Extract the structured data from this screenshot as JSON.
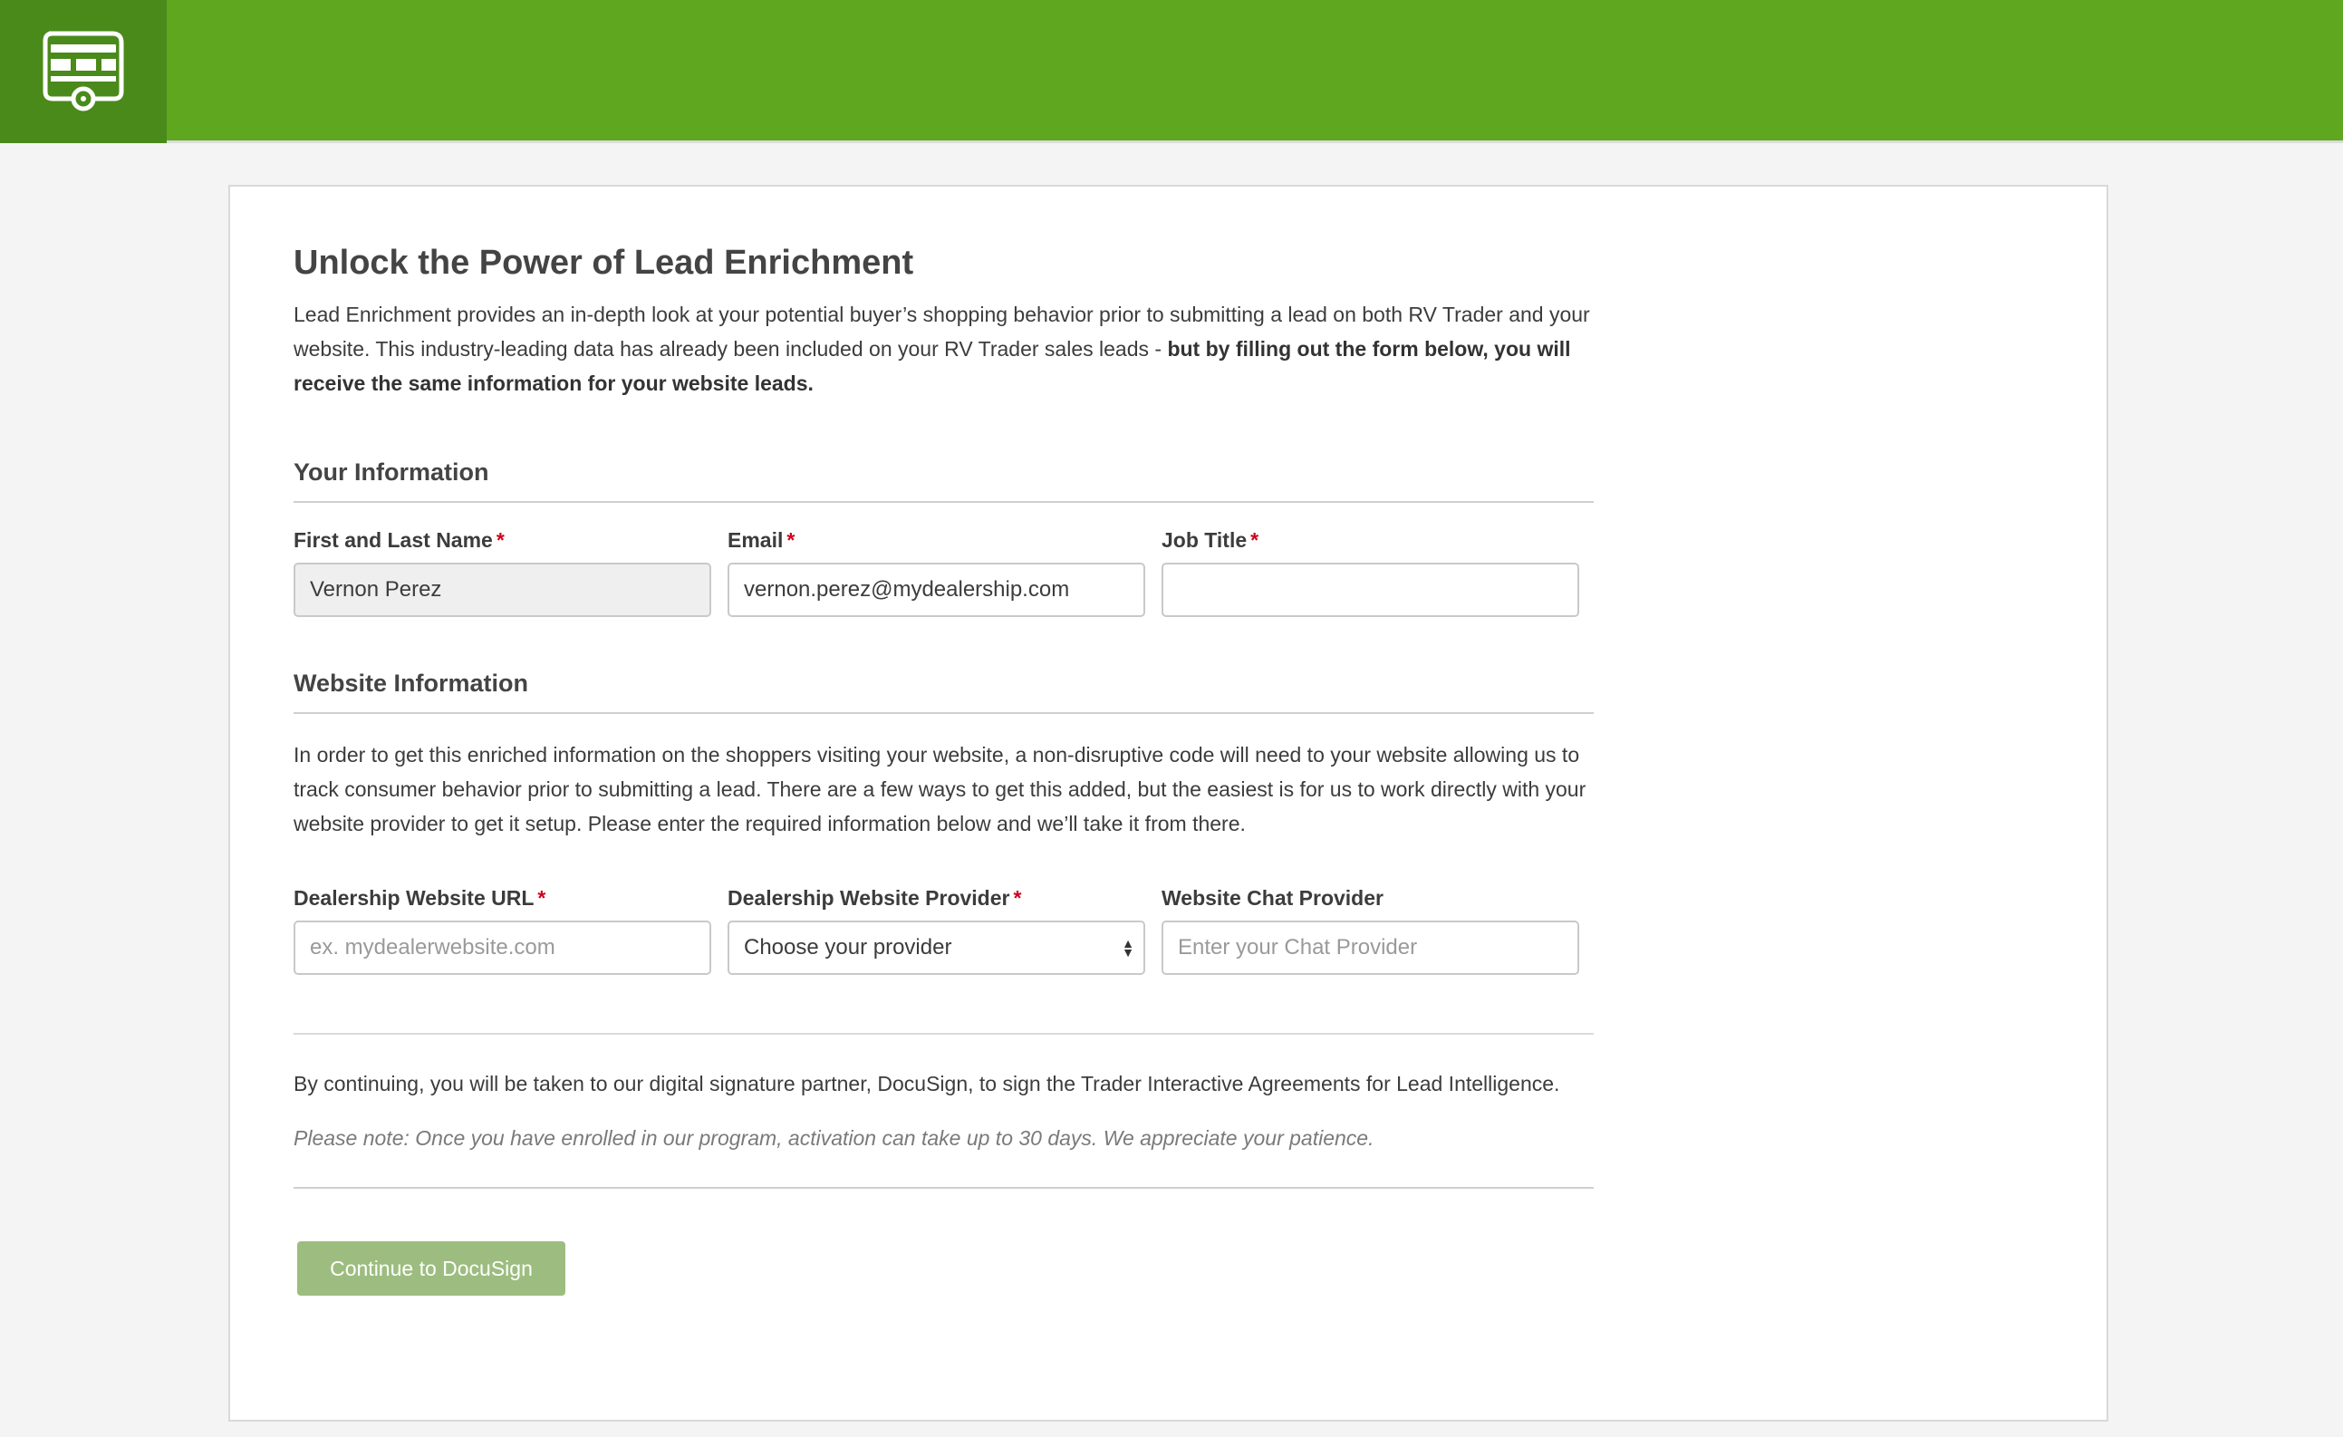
{
  "colors": {
    "header_bg": "#5ea71f",
    "logo_bg": "#4a8a1a",
    "required_star": "#d0021b",
    "button_bg": "#9cbd7f"
  },
  "header": {
    "logo_icon": "rv-camper-icon"
  },
  "page": {
    "title": "Unlock the Power of Lead Enrichment",
    "intro_regular": "Lead Enrichment provides an in-depth look at your potential buyer’s shopping behavior prior to submitting a lead on both RV Trader and your website. This industry-leading data has already been included on your RV Trader sales leads - ",
    "intro_bold": "but by filling out the form below, you will receive the same information for your website leads."
  },
  "your_information": {
    "heading": "Your Information",
    "name": {
      "label": "First and Last Name",
      "required": "*",
      "value": "Vernon Perez"
    },
    "email": {
      "label": "Email",
      "required": "*",
      "value": "vernon.perez@mydealership.com"
    },
    "job_title": {
      "label": "Job Title",
      "required": "*",
      "value": ""
    }
  },
  "website_information": {
    "heading": "Website Information",
    "description": "In order to get this enriched information on the shoppers visiting your website, a non-disruptive code will need to your website allowing us to track consumer behavior prior to submitting a lead. There are a few ways to get this added, but the easiest is for us to work directly with your website provider to get it setup. Please enter the required information below and we’ll take it from there.",
    "url": {
      "label": "Dealership Website URL",
      "required": "*",
      "placeholder": "ex. mydealerwebsite.com"
    },
    "provider": {
      "label": "Dealership Website Provider",
      "required": "*",
      "selected": "Choose your provider"
    },
    "chat": {
      "label": "Website Chat Provider",
      "placeholder": "Enter your Chat Provider"
    }
  },
  "footer": {
    "agreement": "By continuing, you will be taken to our digital signature partner, DocuSign, to sign the Trader Interactive Agreements for Lead Intelligence.",
    "note": "Please note: Once you have enrolled in our program, activation can take up to 30 days. We appreciate your patience.",
    "button_label": "Continue to DocuSign"
  }
}
